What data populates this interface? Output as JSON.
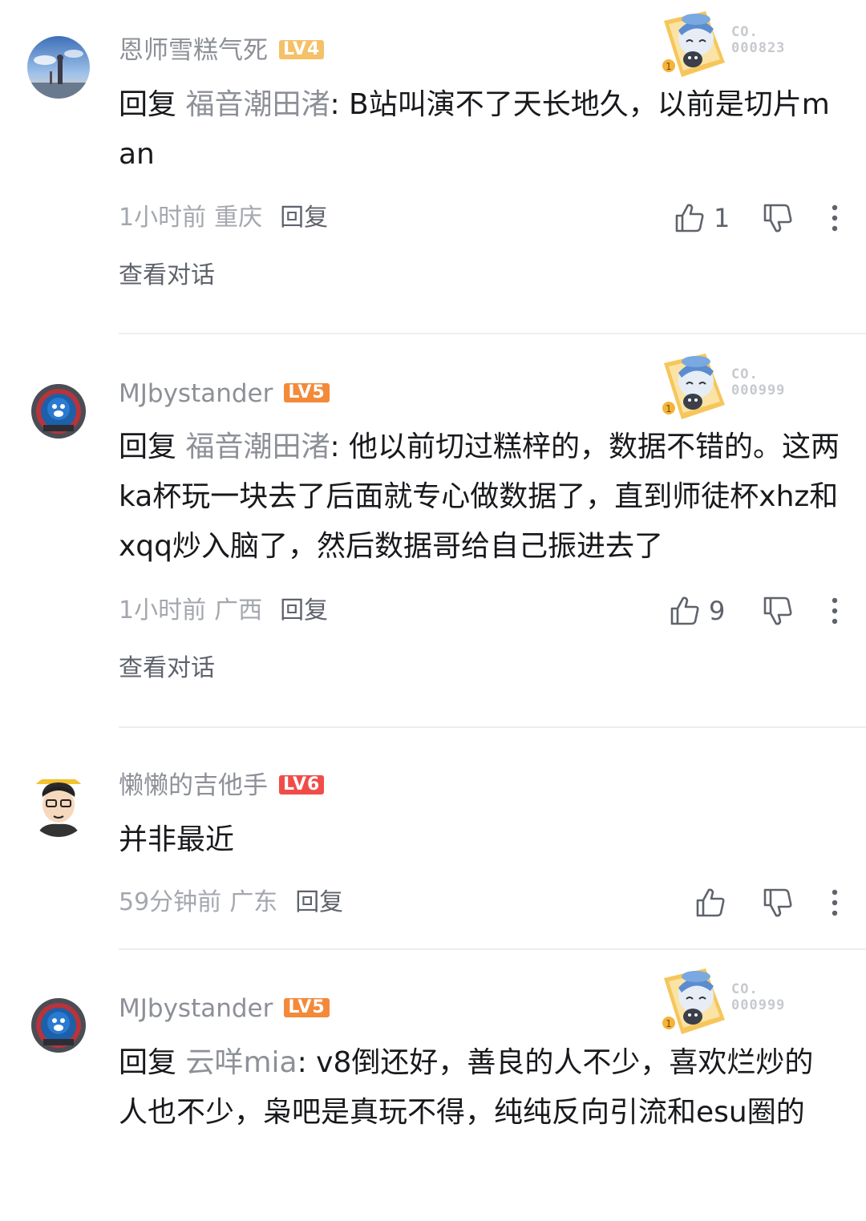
{
  "comments": [
    {
      "username": "恩师雪糕气死",
      "level": "LV4",
      "badge_text_line1": "CO.",
      "badge_text_line2": "000823",
      "reply_prefix": "回复",
      "reply_target": "福音潮田渚",
      "body": ": B站叫演不了天长地久，以前是切片man",
      "time": "1小时前",
      "location": "重庆",
      "reply_label": "回复",
      "like_count": "1",
      "view_conversation": "查看对话"
    },
    {
      "username": "MJbystander",
      "level": "LV5",
      "badge_text_line1": "CO.",
      "badge_text_line2": "000999",
      "reply_prefix": "回复",
      "reply_target": "福音潮田渚",
      "body": ": 他以前切过糕梓的，数据不错的。这两ka杯玩一块去了后面就专心做数据了，直到师徒杯xhz和xqq炒入脑了，然后数据哥给自己振进去了",
      "time": "1小时前",
      "location": "广西",
      "reply_label": "回复",
      "like_count": "9",
      "view_conversation": "查看对话"
    },
    {
      "username": "懒懒的吉他手",
      "level": "LV6",
      "body": "并非最近",
      "time": "59分钟前",
      "location": "广东",
      "reply_label": "回复",
      "like_count": ""
    },
    {
      "username": "MJbystander",
      "level": "LV5",
      "badge_text_line1": "CO.",
      "badge_text_line2": "000999",
      "reply_prefix": "回复",
      "reply_target": "云咩mia",
      "body": ": v8倒还好，善良的人不少，喜欢烂炒的人也不少，枭吧是真玩不得，纯纯反向引流和esu圈的"
    }
  ]
}
